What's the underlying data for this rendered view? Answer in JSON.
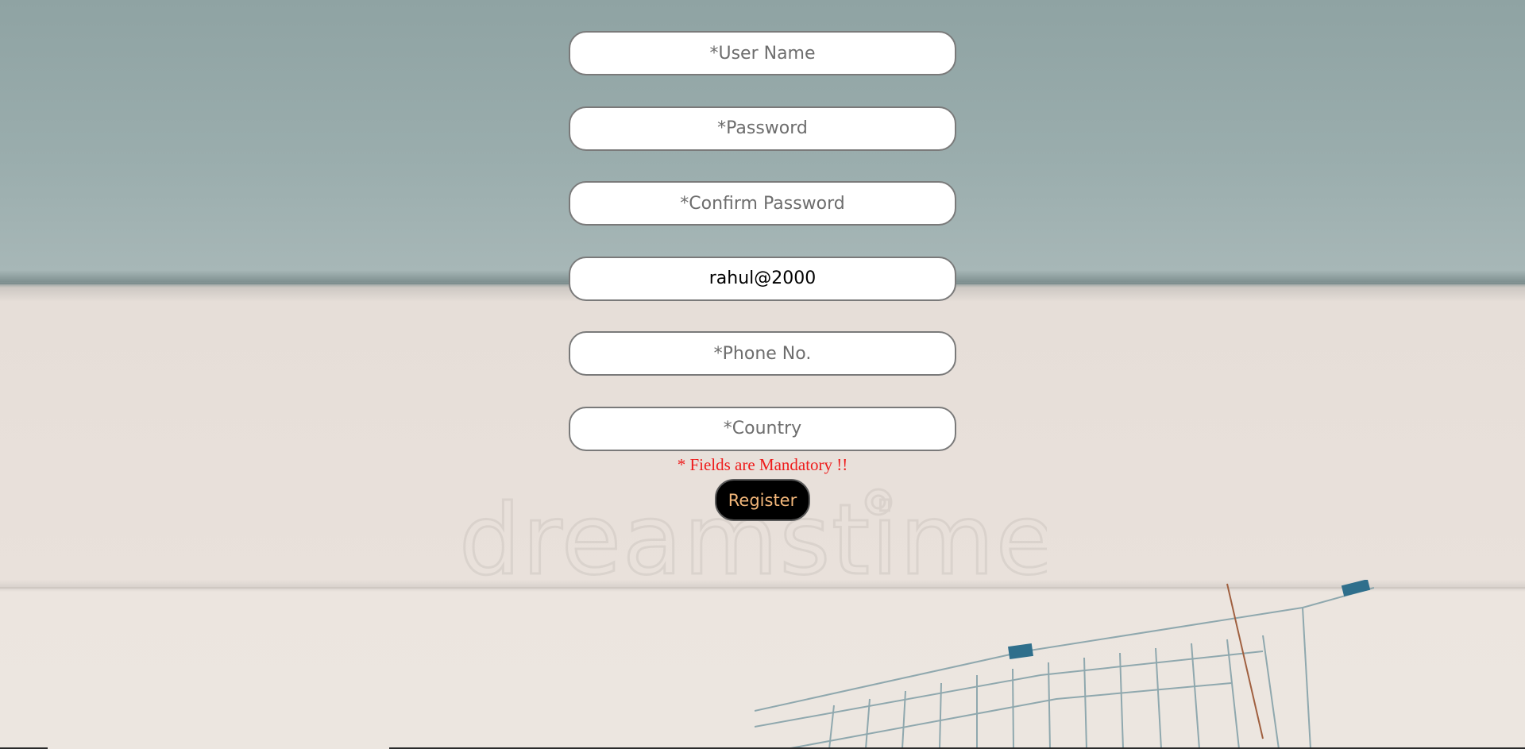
{
  "form": {
    "username_placeholder": "*User Name",
    "password_placeholder": "*Password",
    "confirm_password_placeholder": "*Confirm Password",
    "email_value": "rahul@2000",
    "phone_placeholder": "*Phone No.",
    "country_placeholder": "*Country",
    "mandatory_note": "* Fields are Mandatory !!",
    "register_label": "Register"
  },
  "background": {
    "watermark_text": "dreamstime",
    "image_subject": "shopping-cart-icon"
  },
  "colors": {
    "mandatory_text": "#ee1c1c",
    "register_bg": "#000000",
    "register_text": "#f3b77a",
    "field_border": "#7a7a7a"
  }
}
